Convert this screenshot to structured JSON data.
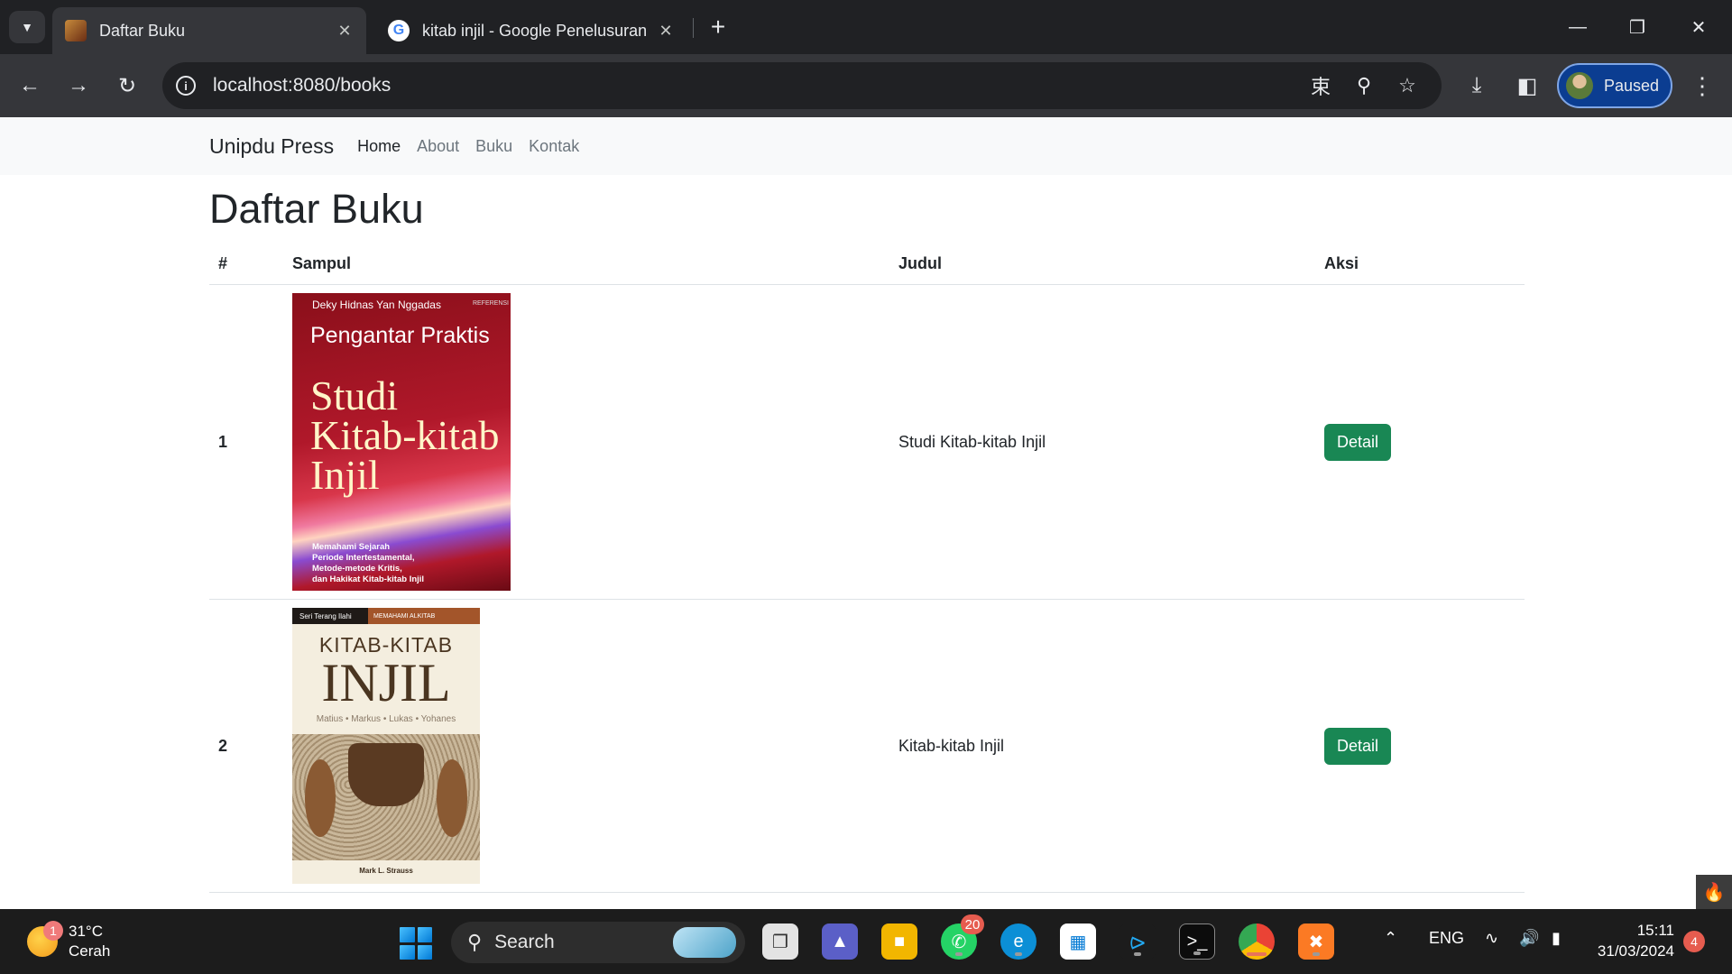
{
  "browser": {
    "tabs": [
      {
        "title": "Daftar Buku",
        "favicon": "book-cover-favicon",
        "active": true
      },
      {
        "title": "kitab injil - Google Penelusuran",
        "favicon": "google-favicon",
        "active": false
      }
    ],
    "address": "localhost:8080/books",
    "profile_label": "Paused",
    "accent": "#0b3d91"
  },
  "site": {
    "brand": "Unipdu Press",
    "nav": [
      "Home",
      "About",
      "Buku",
      "Kontak"
    ],
    "nav_active": "Home"
  },
  "page": {
    "heading": "Daftar Buku",
    "columns": [
      "#",
      "Sampul",
      "Judul",
      "Aksi"
    ],
    "rows": [
      {
        "num": "1",
        "title": "Studi Kitab-kitab Injil",
        "action": "Detail",
        "cover": {
          "author": "Deky Hidnas Yan Nggadas",
          "badge": "REFERENSI",
          "pre": "Pengantar Praktis",
          "main_1": "Studi",
          "main_2": "Kitab-kitab",
          "main_3": "Injil",
          "foot_1": "Memahami Sejarah",
          "foot_2": "Periode Intertestamental,",
          "foot_3": "Metode-metode Kritis,",
          "foot_4": "dan Hakikat Kitab-kitab Injil"
        }
      },
      {
        "num": "2",
        "title": "Kitab-kitab Injil",
        "action": "Detail",
        "cover": {
          "series": "Seri Terang Ilahi",
          "tag": "MEMAHAMI ALKITAB",
          "t1": "KITAB-KITAB",
          "t2": "INJIL",
          "t3": "Matius • Markus • Lukas • Yohanes",
          "author": "Mark L. Strauss"
        }
      }
    ],
    "button_color": "#198754"
  },
  "taskbar": {
    "weather_temp": "31°C",
    "weather_desc": "Cerah",
    "weather_badge": "1",
    "search_label": "Search",
    "whatsapp_badge": "20",
    "language": "ENG",
    "time": "15:11",
    "date": "31/03/2024",
    "notification_count": "4"
  }
}
